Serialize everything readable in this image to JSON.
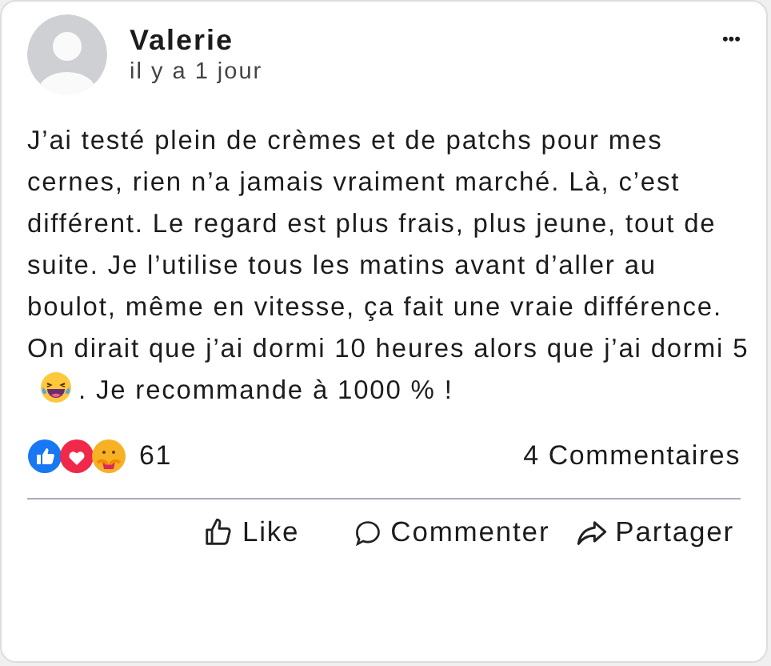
{
  "post": {
    "author": "Valerie",
    "time": "il y a 1 jour",
    "menu": "•••",
    "body_before": "J’ai testé plein de crèmes et de patchs pour mes cernes, rien n’a jamais vraiment marché. Là, c’est différent. Le regard est plus frais, plus jeune, tout de suite. Je l’utilise tous les matins avant d’aller au boulot, même en vitesse, ça fait une vraie différence. On dirait que j’ai dormi 10 heures alors que j’ai dormi 5",
    "body_after": ". Je recommande à 1000 % !"
  },
  "reactions": {
    "count": "61",
    "comments": "4 Commentaires"
  },
  "actions": [
    {
      "kind": "like",
      "label": "Like"
    },
    {
      "kind": "comment",
      "label": "Commenter"
    },
    {
      "kind": "share",
      "label": "Partager"
    }
  ]
}
